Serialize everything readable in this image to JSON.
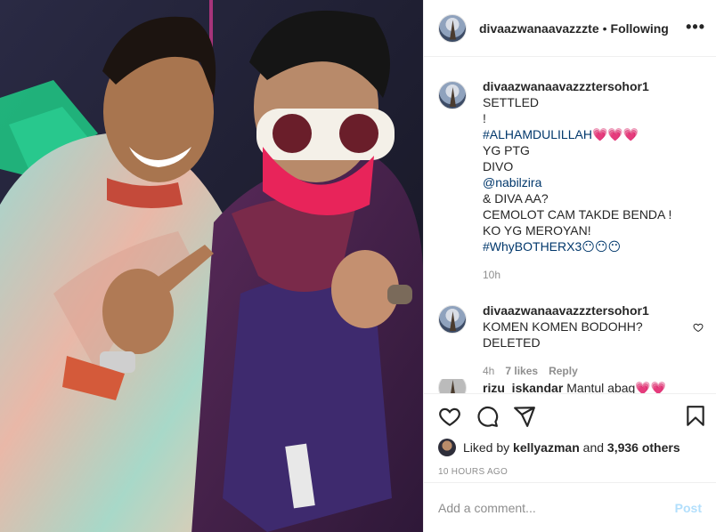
{
  "header": {
    "username": "divaazwanaavazzzte",
    "separator": "•",
    "follow_label": "Following",
    "more_label": "•••"
  },
  "caption": {
    "username": "divaazwanaavazzztersohor1",
    "first": "SETTLED",
    "lines": [
      "!",
      "#ALHAMDULILLAH💗💗💗",
      "YG PTG",
      "DIVO",
      "@nabilzira",
      "& DIVA AA?",
      "CEMOLOT CAM TAKDE BENDA !",
      "KO YG MEROYAN!",
      "#WhyBOTHERX3😶😶😶"
    ],
    "time": "10h"
  },
  "comment": {
    "username": "divaazwanaavazzztersohor1",
    "lines": [
      "KOMEN KOMEN BODOHH?",
      "DELETED"
    ],
    "time": "4h",
    "likes": "7 likes",
    "reply": "Reply"
  },
  "cut_comment": {
    "username": "rizu_iskandar",
    "text": "Mantul abag💗💗"
  },
  "likes": {
    "prefix": "Liked by",
    "user": "kellyazman",
    "and": "and",
    "count": "3,936 others"
  },
  "timestamp": "10 HOURS AGO",
  "add_comment": {
    "placeholder": "Add a comment...",
    "post_label": "Post"
  },
  "colors": {
    "link": "#00376b",
    "muted": "#8e8e8e",
    "post": "#b2dffc"
  }
}
